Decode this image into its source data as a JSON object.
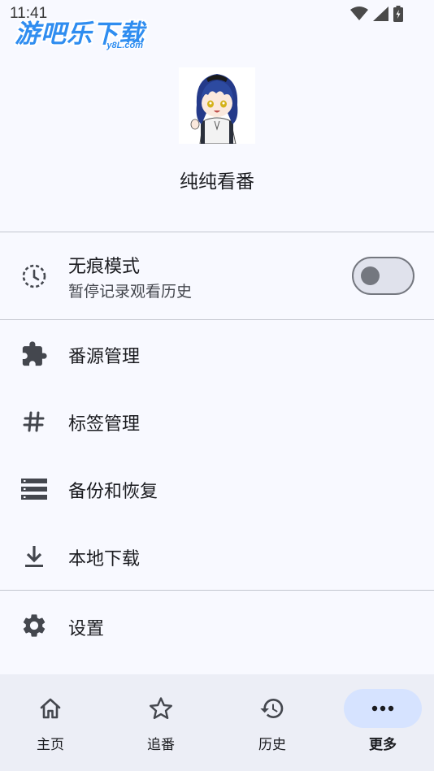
{
  "status_bar": {
    "time": "11:41"
  },
  "watermark": {
    "title": "游吧乐下载",
    "sub": "y8L.com"
  },
  "profile": {
    "name": "纯纯看番"
  },
  "incognito": {
    "title": "无痕模式",
    "subtitle": "暂停记录观看历史",
    "enabled": false
  },
  "menu": {
    "items": [
      {
        "label": "番源管理",
        "icon": "puzzle-icon"
      },
      {
        "label": "标签管理",
        "icon": "hash-icon"
      },
      {
        "label": "备份和恢复",
        "icon": "storage-icon"
      },
      {
        "label": "本地下载",
        "icon": "download-icon"
      }
    ],
    "settings": {
      "label": "设置",
      "icon": "gear-icon"
    }
  },
  "bottom_nav": {
    "items": [
      {
        "label": "主页",
        "icon": "home-icon",
        "active": false
      },
      {
        "label": "追番",
        "icon": "star-icon",
        "active": false
      },
      {
        "label": "历史",
        "icon": "history-icon",
        "active": false
      },
      {
        "label": "更多",
        "icon": "more-icon",
        "active": true
      }
    ]
  },
  "colors": {
    "background": "#f8f9ff",
    "nav_background": "#eceef6",
    "active_pill": "#d6e3ff",
    "watermark": "#2f8df0"
  }
}
